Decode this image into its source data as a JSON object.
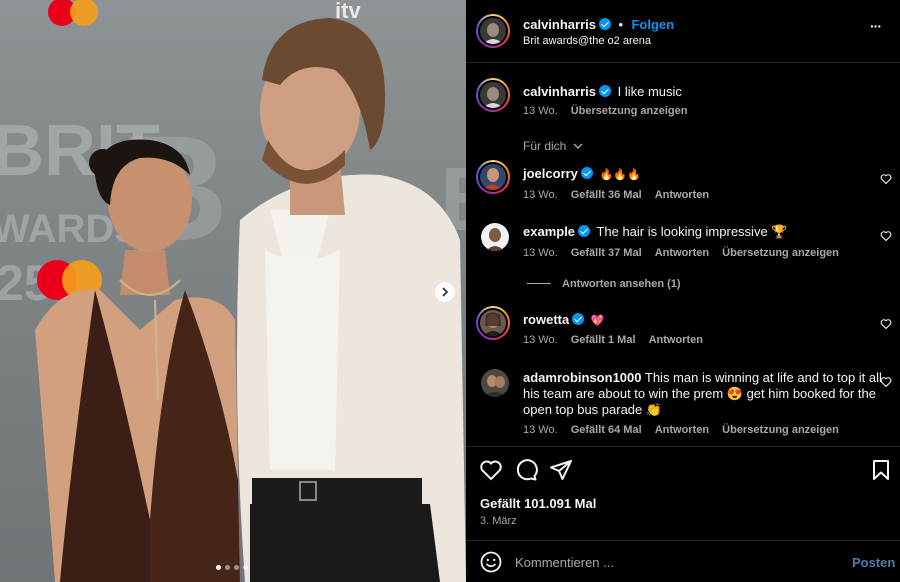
{
  "post": {
    "username": "calvinharris",
    "separator": "•",
    "follow_label": "Folgen",
    "location": "Brit awards@the o2 arena",
    "more_label": "···"
  },
  "caption": {
    "username": "calvinharris",
    "text": "I like music",
    "time": "13 Wo.",
    "translate": "Übersetzung anzeigen"
  },
  "filter_label": "Für dich",
  "comments": [
    {
      "username": "joelcorry",
      "text": "🔥🔥🔥",
      "time": "13 Wo.",
      "likes": "Gefällt 36 Mal",
      "reply": "Antworten",
      "translate": ""
    },
    {
      "username": "example",
      "text": "The hair is looking impressive 🏆",
      "time": "13 Wo.",
      "likes": "Gefällt 37 Mal",
      "reply": "Antworten",
      "translate": "Übersetzung anzeigen"
    },
    {
      "username": "rowetta",
      "text": "💖",
      "time": "13 Wo.",
      "likes": "Gefällt 1 Mal",
      "reply": "Antworten",
      "translate": ""
    },
    {
      "username": "adamrobinson1000",
      "text_line1": "This man is winning at life and to top it all",
      "text_line2": "his team are about to win the prem 😍 get him booked for the",
      "text_line3": "open top bus parade 👏",
      "time": "13 Wo.",
      "likes": "Gefällt 64 Mal",
      "reply": "Antworten",
      "translate": "Übersetzung anzeigen"
    }
  ],
  "view_replies": "Antworten ansehen (1)",
  "likes_total": "Gefällt 101.091 Mal",
  "date": "3. März",
  "comment_input": {
    "placeholder": "Kommentieren ..."
  },
  "post_button": "Posten",
  "carousel": {
    "slides": 4,
    "active": 0
  },
  "colors": {
    "verified": "#0095f6",
    "follow": "#0095f6",
    "post_button": "#4c7da8",
    "secondary_text": "#a8a8a8"
  },
  "icons": [
    "like-icon",
    "comment-icon",
    "share-icon",
    "save-icon",
    "emoji-icon",
    "more-icon",
    "verified-icon",
    "next-arrow-icon"
  ]
}
